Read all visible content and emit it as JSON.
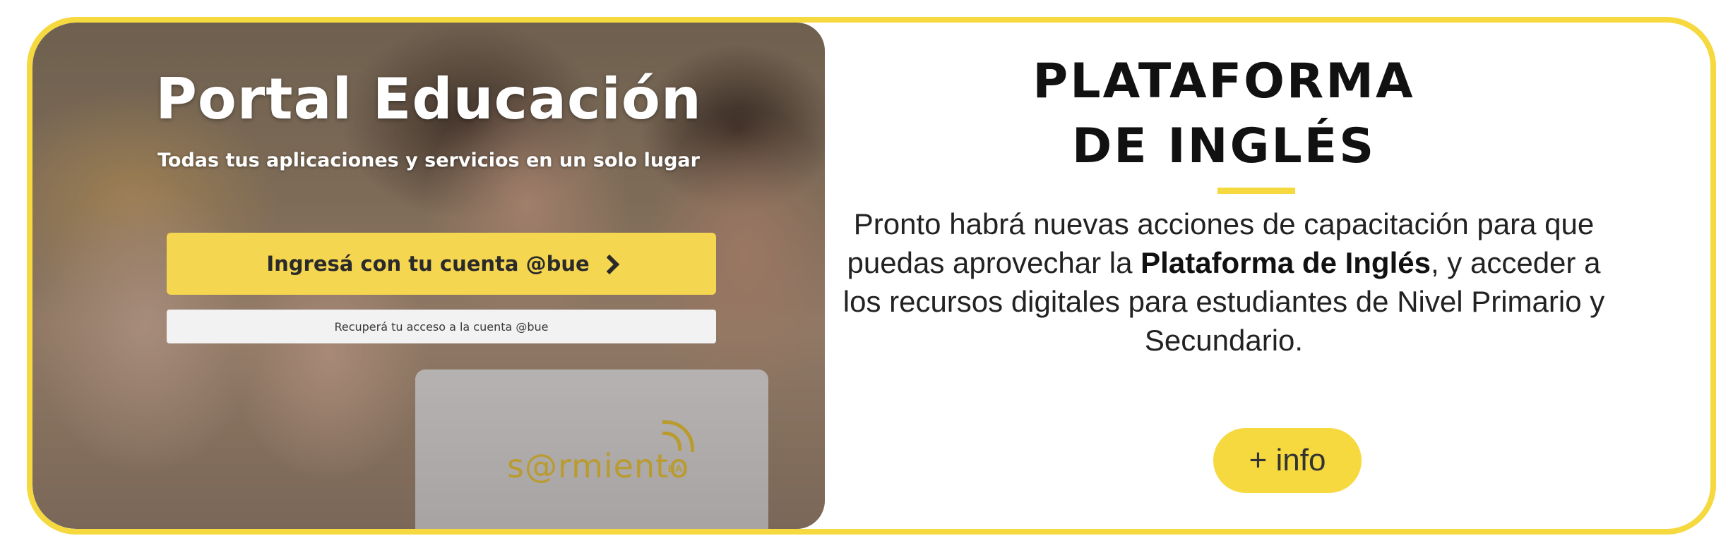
{
  "portal": {
    "title": "Portal Educación",
    "subtitle": "Todas tus aplicaciones y servicios en un solo lugar",
    "login_button": "Ingresá con tu cuenta @bue",
    "recover_link": "Recuperá tu acceso a la cuenta @bue",
    "laptop_logo": "s@rmiento",
    "laptop_logo_suffix": "BA"
  },
  "panel": {
    "heading_line1": "PLATAFORMA",
    "heading_line2": "DE INGLÉS",
    "body_before": "Pronto habrá nuevas acciones de capacitación para que puedas aprovechar la ",
    "body_bold": "Plataforma de Inglés",
    "body_after": ", y acceder a los recursos digitales para estudiantes de Nivel Primario y Secundario.",
    "info_button": "+ info"
  },
  "colors": {
    "accent_yellow": "#f5d93f",
    "button_yellow": "#f5d650"
  }
}
